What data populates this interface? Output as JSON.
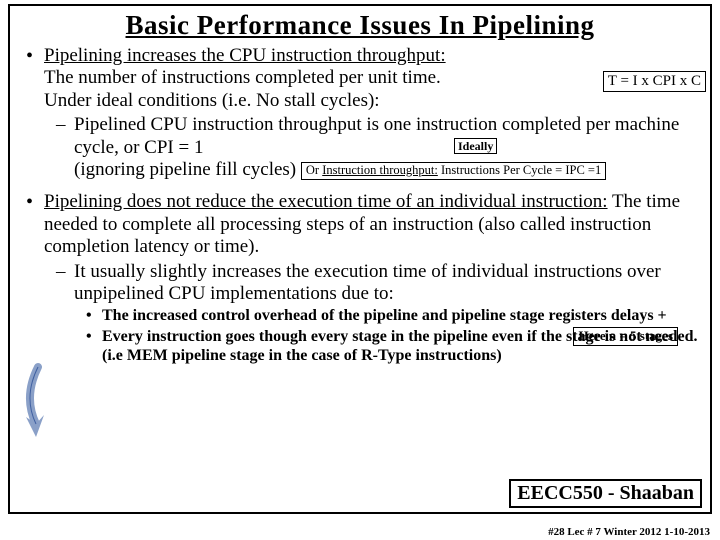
{
  "title": "Basic Performance Issues In Pipelining",
  "p1": {
    "lead": "Pipelining increases the CPU instruction throughput:",
    "line1": "The number of instructions completed per unit time.",
    "line2": "Under ideal conditions (i.e. No stall cycles):",
    "formula": "T = I x CPI x C",
    "sub1a": "Pipelined CPU instruction throughput is one instruction completed per machine cycle, or  CPI = 1",
    "ideally": "Ideally",
    "sub1b": "(ignoring pipeline fill cycles)",
    "ipc_box": "Or Instruction throughput: Instructions Per Cycle = IPC =1"
  },
  "p2": {
    "lead": "Pipelining does not reduce the execution time of an individual instruction:",
    "rest": "  The time needed to complete all processing steps of an instruction (also called instruction completion latency or time).",
    "sub1": "It usually slightly increases the execution time of individual instructions over unpipelined CPU implementations due to:",
    "bb1": "The increased control overhead of the pipeline and pipeline stage registers delays  +",
    "nstages": "Here n = 5 stages",
    "bb2": "Every instruction goes though every stage in the pipeline even if the stage is not needed.  (i.e MEM pipeline stage in the case of R-Type instructions)"
  },
  "course": "EECC550 - Shaaban",
  "footer": "#28   Lec # 7  Winter 2012  1-10-2013"
}
